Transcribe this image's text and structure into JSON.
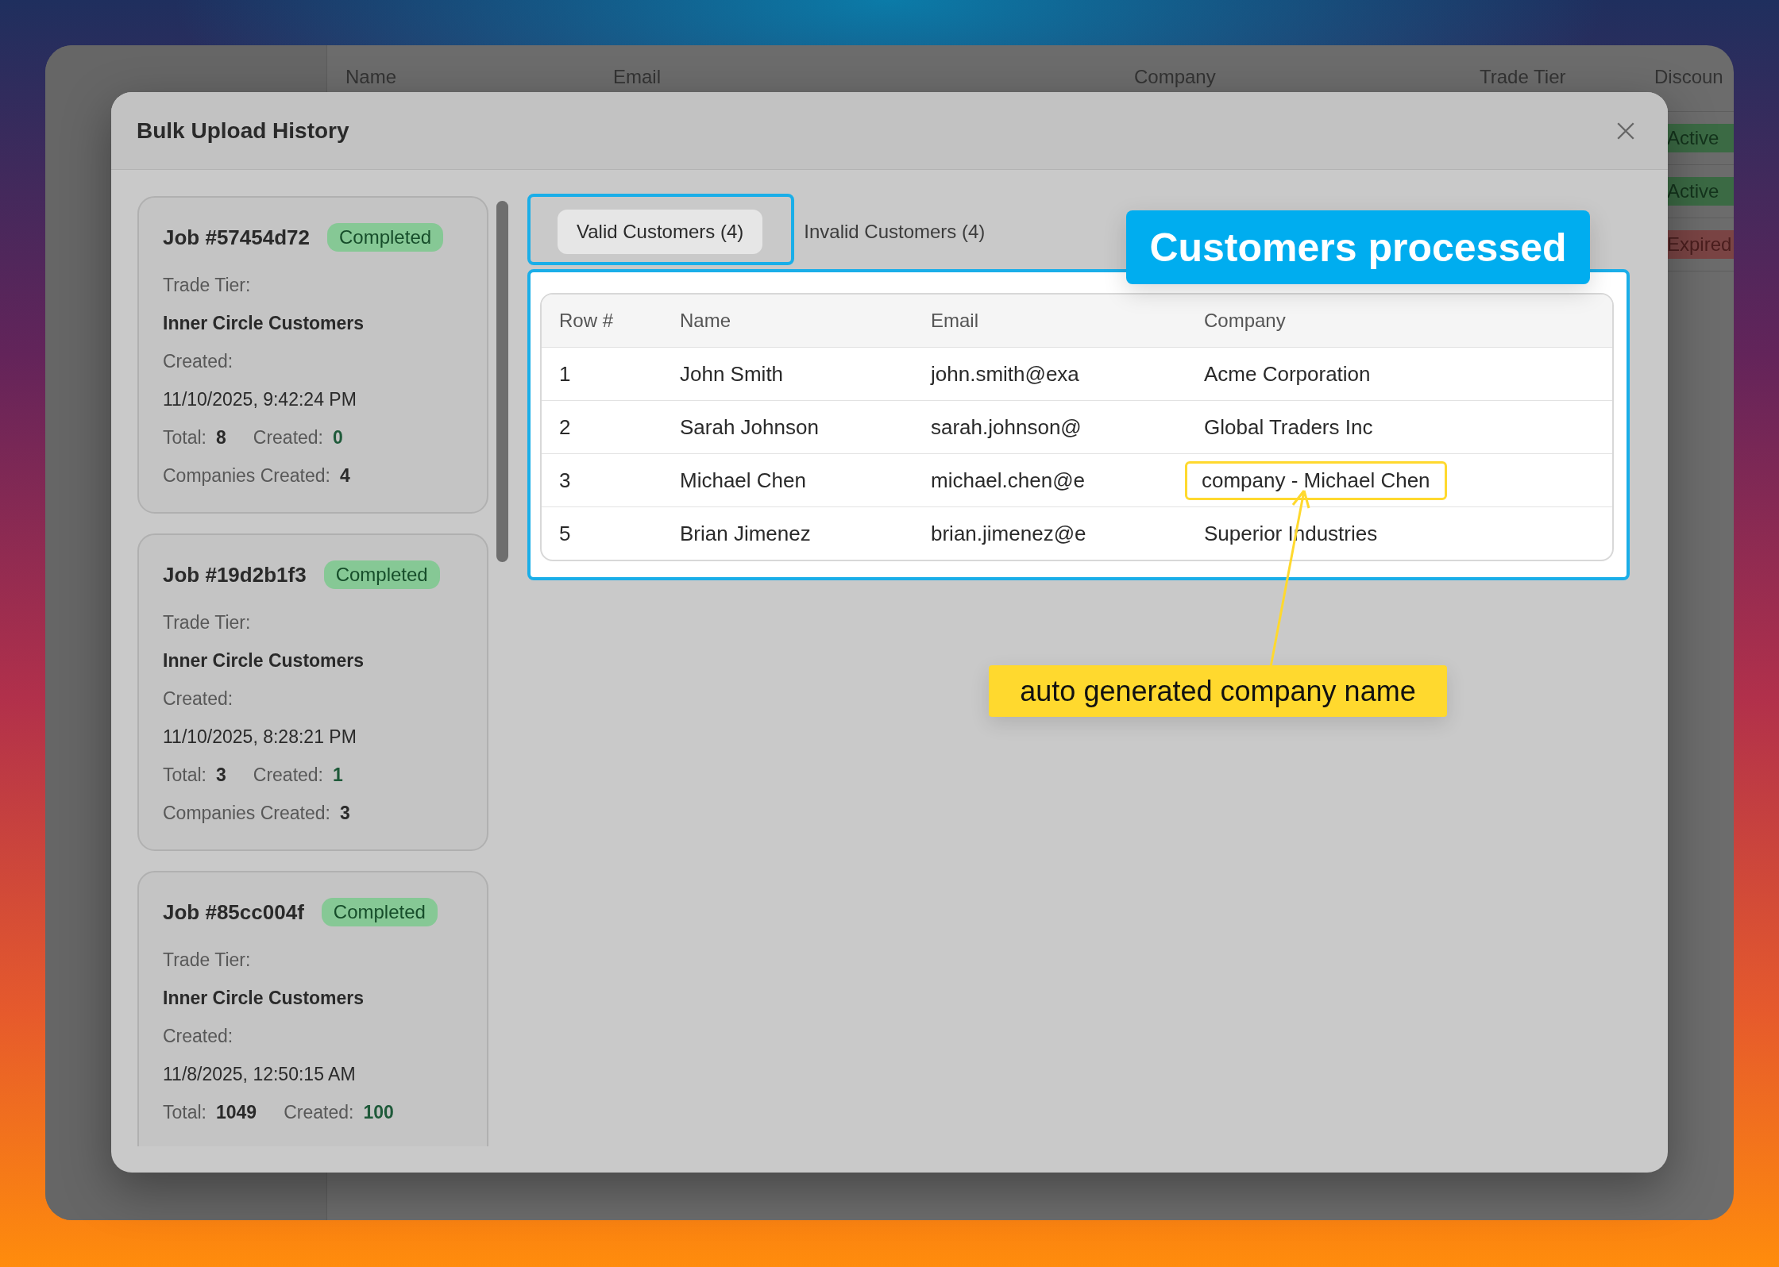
{
  "background_app": {
    "columns": [
      "Name",
      "Email",
      "Company",
      "Trade Tier",
      "Discoun"
    ],
    "statuses": [
      {
        "label": "Active",
        "kind": "active"
      },
      {
        "label": "Active",
        "kind": "active"
      },
      {
        "label": "Expired",
        "kind": "expired"
      }
    ]
  },
  "modal": {
    "title": "Bulk Upload History",
    "closable": true
  },
  "jobs": [
    {
      "title": "Job #57454d72",
      "status": "Completed",
      "trade_tier_label": "Trade Tier:",
      "trade_tier": "Inner Circle Customers",
      "created_label": "Created:",
      "created": "11/10/2025, 9:42:24 PM",
      "total_label": "Total:",
      "total": "8",
      "created_count_label": "Created:",
      "created_count": "0",
      "companies_label": "Companies Created:",
      "companies": "4"
    },
    {
      "title": "Job #19d2b1f3",
      "status": "Completed",
      "trade_tier_label": "Trade Tier:",
      "trade_tier": "Inner Circle Customers",
      "created_label": "Created:",
      "created": "11/10/2025, 8:28:21 PM",
      "total_label": "Total:",
      "total": "3",
      "created_count_label": "Created:",
      "created_count": "1",
      "companies_label": "Companies Created:",
      "companies": "3"
    },
    {
      "title": "Job #85cc004f",
      "status": "Completed",
      "trade_tier_label": "Trade Tier:",
      "trade_tier": "Inner Circle Customers",
      "created_label": "Created:",
      "created": "11/8/2025, 12:50:15 AM",
      "total_label": "Total:",
      "total": "1049",
      "created_count_label": "Created:",
      "created_count": "100"
    }
  ],
  "tabs": [
    {
      "label": "Valid Customers (4)",
      "selected": true
    },
    {
      "label": "Invalid Customers (4)",
      "selected": false
    }
  ],
  "table": {
    "columns": [
      "Row #",
      "Name",
      "Email",
      "Company"
    ],
    "rows": [
      {
        "row": "1",
        "name": "John Smith",
        "email": "john.smith@exa",
        "company": "Acme Corporation",
        "highlighted": false
      },
      {
        "row": "2",
        "name": "Sarah Johnson",
        "email": "sarah.johnson@",
        "company": "Global Traders Inc",
        "highlighted": false
      },
      {
        "row": "3",
        "name": "Michael Chen",
        "email": "michael.chen@e",
        "company": "company - Michael Chen",
        "highlighted": true
      },
      {
        "row": "5",
        "name": "Brian Jimenez",
        "email": "brian.jimenez@e",
        "company": "Superior Industries",
        "highlighted": false
      }
    ]
  },
  "annotations": {
    "callout": "Customers processed",
    "note": "auto generated company name"
  }
}
